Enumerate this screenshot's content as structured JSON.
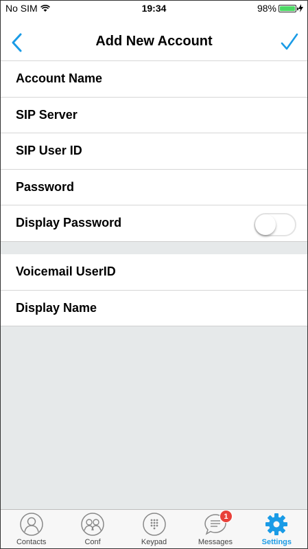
{
  "status": {
    "carrier": "No SIM",
    "time": "19:34",
    "battery": "98%",
    "battery_level": 0.98
  },
  "nav": {
    "title": "Add New Account"
  },
  "form": {
    "section1": [
      {
        "label": "Account Name"
      },
      {
        "label": "SIP Server"
      },
      {
        "label": "SIP User ID"
      },
      {
        "label": "Password"
      }
    ],
    "display_password_label": "Display Password",
    "display_password_on": false,
    "section2": [
      {
        "label": "Voicemail UserID"
      },
      {
        "label": "Display Name"
      }
    ]
  },
  "tabs": [
    {
      "label": "Contacts",
      "icon": "contacts-icon"
    },
    {
      "label": "Conf",
      "icon": "conference-icon"
    },
    {
      "label": "Keypad",
      "icon": "keypad-icon"
    },
    {
      "label": "Messages",
      "icon": "messages-icon",
      "badge": "1"
    },
    {
      "label": "Settings",
      "icon": "gear-icon",
      "active": true
    }
  ],
  "colors": {
    "accent": "#1a9be6",
    "badge": "#e8413a",
    "background": "#e6e9ea"
  }
}
